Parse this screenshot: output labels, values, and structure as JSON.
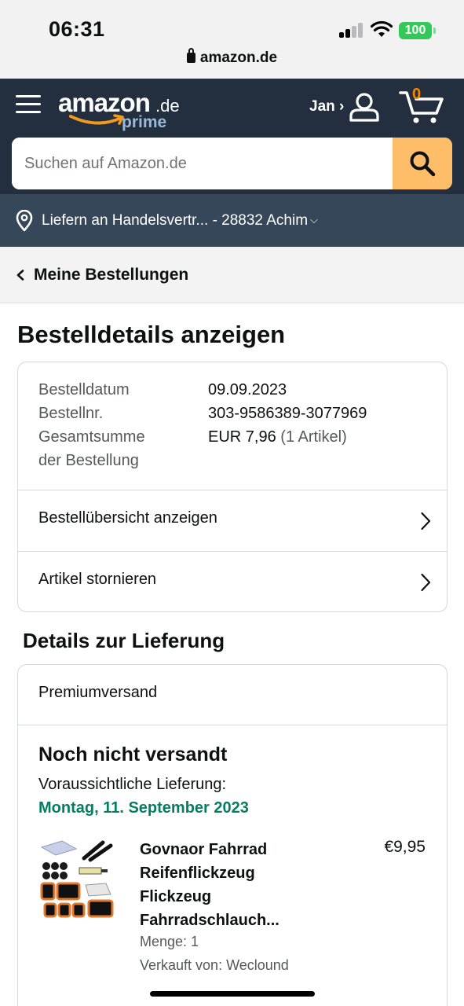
{
  "status_bar": {
    "time": "06:31",
    "battery": "100",
    "url": "amazon.de",
    "icons": [
      "signal-icon",
      "wifi-icon",
      "battery-icon",
      "lock-icon"
    ]
  },
  "header": {
    "logo_text": "amazon",
    "logo_tld": ".de",
    "logo_sub": "prime",
    "account_name": "Jan",
    "account_chevron": "›",
    "cart_count": "0",
    "search_placeholder": "Suchen auf Amazon.de",
    "deliver_to": "Liefern an Handelsvertr... - 28832 Achim",
    "deliver_chevron": "⌵",
    "colors": {
      "header_bg": "#232f3e",
      "subheader_bg": "#37475a",
      "search_button": "#febd69",
      "cart_count": "#f08804"
    }
  },
  "breadcrumb": {
    "label": "Meine Bestellungen"
  },
  "page": {
    "title": "Bestelldetails anzeigen"
  },
  "order_summary": {
    "rows": [
      {
        "label": "Bestelldatum",
        "value": "09.09.2023"
      },
      {
        "label": "Bestellnr.",
        "value": "303-9586389-3077969"
      },
      {
        "label": "Gesamtsumme",
        "label2": "der Bestellung",
        "value": "EUR 7,96",
        "value_note": "(1 Artikel)"
      }
    ],
    "links": [
      {
        "label": "Bestellübersicht anzeigen"
      },
      {
        "label": "Artikel stornieren"
      }
    ]
  },
  "delivery": {
    "section_title": "Details zur Lieferung",
    "shipping_method": "Premiumversand",
    "status": "Noch nicht versandt",
    "eta_label": "Voraussichtliche Lieferung:",
    "eta_date": "Montag, 11. September 2023",
    "eta_color": "#067d62",
    "product": {
      "title": "Govnaor Fahrrad Reifenflickzeug Flickzeug Fahrradschlauch...",
      "price": "€9,95",
      "quantity": "Menge: 1",
      "seller": "Verkauft von: Weclound"
    }
  }
}
